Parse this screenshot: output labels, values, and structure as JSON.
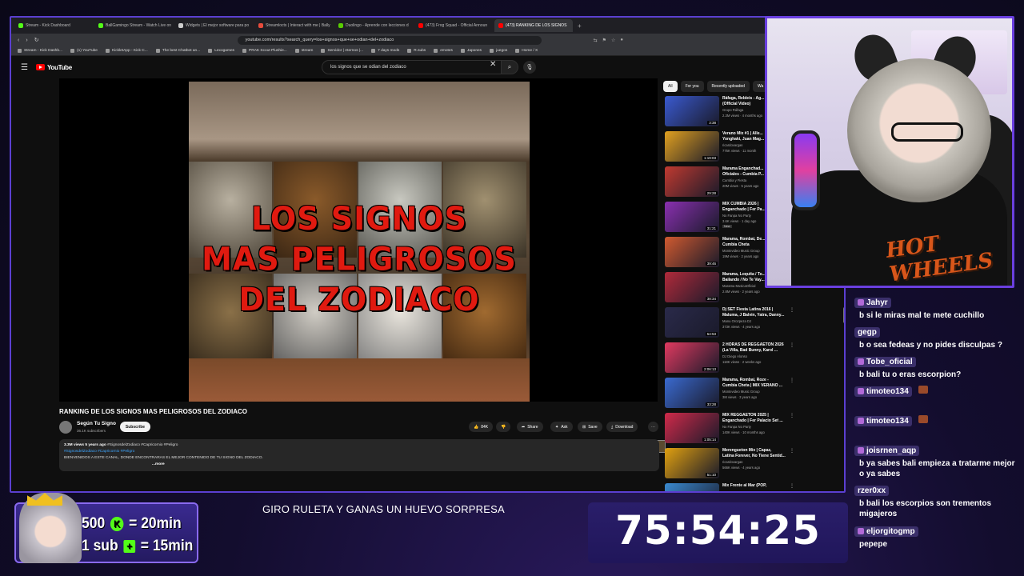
{
  "browser": {
    "tabs": [
      {
        "label": "Stream - Kick Dashboard",
        "color": "#53fc18"
      },
      {
        "label": "BallGamingo Stream - Watch Live on",
        "color": "#53fc18"
      },
      {
        "label": "Widgets | El mejor software para po",
        "color": "#cccccc"
      },
      {
        "label": "Streamlocts | Interact with me | Bally",
        "color": "#e74c3c"
      },
      {
        "label": "Duolingo - Aprende con lecciones d",
        "color": "#58cc02"
      },
      {
        "label": "(473) Frog Squad - Official Announ",
        "color": "#ff0000"
      },
      {
        "label": "(473) RANKING DE LOS SIGNOS",
        "color": "#ff0000"
      }
    ],
    "new_tab": "+",
    "url": "youtube.com/results?search_query=los+signos+que+se+odian+del+zodiaco",
    "bookmarks": [
      "Stream - Kick Dashb...",
      "(1) YouTube",
      "KickletApp - Kick C...",
      "The best Chatbot an...",
      "Lexogames",
      "PRAK Scout Plushie...",
      "stream",
      "Servidor | Aternos |...",
      "7 days mods",
      "R.subs",
      "emotes",
      "Japones",
      "juegos",
      "Home / X"
    ]
  },
  "youtube": {
    "logo": "YouTube",
    "search_value": "los signos que se odian del zodiaco",
    "thumbnail_text": "LOS SIGNOS\nMAS PELIGROSOS\nDEL ZODIACO",
    "video_title": "RANKING DE LOS SIGNOS MAS PELIGROSOS DEL ZODIACO",
    "channel_name": "Según Tu Signo",
    "channel_subs": "36.1K subscribers",
    "subscribe_label": "Subscribe",
    "like_count": "84K",
    "share_label": "Share",
    "ask_label": "Ask",
    "save_label": "Save",
    "download_label": "Download",
    "desc_meta": "3.3M views  5 years ago",
    "desc_meta_tags": "#SignosdelZodiaco #Capricornio #Peligro",
    "desc_tags": "#SignosdelZodiaco #Capricornio #Peligro",
    "desc_text": "BIENVENIDOS A ESTE CANAL, DONDE ENCONTRARAS EL MEJOR CONTENIDO  DE TU SIGNO DEL ZODIACO.",
    "desc_more": "...more",
    "chips": [
      "All",
      "For you",
      "Recently uploaded",
      "Wa"
    ],
    "recommendations": [
      {
        "title": "Ráfaga, Rebleis - Ag...",
        "title2": "(Official Video)",
        "channel": "Grupo Ráfaga",
        "meta": "2.3M views · 4 months ago",
        "duration": "3:38",
        "thumb": "#3a5ad0"
      },
      {
        "title": "Verano Mix #1 | Alle...",
        "title2": "Yonghaki, Juan Mag...",
        "channel": "ricardovargas",
        "meta": "775K views · 11 month",
        "duration": "1:19:03",
        "thumb": "#e0a020"
      },
      {
        "title": "Marama Enganchad...",
        "title2": "Oficiales - Cumbia P...",
        "channel": "Cumbia y Fiesta",
        "meta": "20M views · 5 years ago",
        "duration": "29:28",
        "thumb": "#c03a30"
      },
      {
        "title": "MIX CUMBIA 2026 |",
        "title2": "Enganchado | Fer Pa...",
        "channel": "No Fanpa No Party",
        "meta": "3.6K views · 1 day ago",
        "duration": "31:21",
        "thumb": "#8a30b0",
        "badge": "New"
      },
      {
        "title": "Marama, Rombai, De...",
        "title2": "Cumbia Cheta",
        "channel": "Montevideo Music Group",
        "meta": "19M views · 2 years ago",
        "duration": "39:46",
        "thumb": "#d05a30"
      },
      {
        "title": "Marama, Loquita / To...",
        "title2": "Bailando / No Te Vay...",
        "channel": "Marama MusicaOficial",
        "meta": "2.8M views · 2 years ago",
        "duration": "38:34",
        "thumb": "#b02a3a"
      },
      {
        "title": "Dj SET Fiesta Latina 2016 |",
        "title2": "Maluma, J Balvin, Yatra, Danny...",
        "channel": "Manu Orozpeza DJ",
        "meta": "373K views · 4 years ago",
        "duration": "54:53",
        "thumb": "#2a2a4a"
      },
      {
        "title": "2 HORAS DE REGGAETON 2026",
        "title2": "(La Villa, Bad Bunny, Karol ...",
        "channel": "DJ Diego Alonso",
        "meta": "118K views · 2 weeks ago",
        "duration": "2:06:13",
        "thumb": "#e03a60"
      },
      {
        "title": "Marama, Rombai, Roze -",
        "title2": "Cumbia Cheta | MIX VERANO ...",
        "channel": "Montevideo Music Group",
        "meta": "3M views · 3 years ago",
        "duration": "33:28",
        "thumb": "#3a6ad0"
      },
      {
        "title": "MIX REGGAETON 2025 |",
        "title2": "Enganchado | Fer Palacio Set ...",
        "channel": "No Fanpa No Party",
        "meta": "140K views · 10 months ago",
        "duration": "1:05:14",
        "thumb": "#d02a4a"
      },
      {
        "title": "Merengueton Mix | Capaz,",
        "title2": "Latina Forever, No Tiene Sentid...",
        "channel": "ricardovargas",
        "meta": "566K views · 4 years ago",
        "duration": "51:10",
        "thumb": "#e0a010"
      },
      {
        "title": "Mix Frente al Mar (POP,",
        "title2": "",
        "channel": "",
        "meta": "",
        "duration": "",
        "thumb": "#3a8ad0"
      }
    ]
  },
  "webcam": {
    "shirt_text": "HOT WHEELS"
  },
  "chat": [
    {
      "user": "Jahyr",
      "text": "b si le miras mal te mete cuchillo"
    },
    {
      "user": "gegp",
      "text": "b o sea fedeas y no pides disculpas ?"
    },
    {
      "user": "Tobe_oficial",
      "text": "b bali tu o eras escorpion?"
    },
    {
      "user": "timoteo134",
      "text": ""
    },
    {
      "user": "timoteo134",
      "text": ""
    },
    {
      "user": "joisrnen_aqp",
      "text": "b ya sabes bali empieza a tratarme mejor o ya sabes"
    },
    {
      "user": "rzer0xx",
      "text": "b bali los escorpios son trementos migajeros"
    },
    {
      "user": "eljorgitogmp",
      "text": "pepepe"
    }
  ],
  "overlay": {
    "promo_line1_a": "500",
    "promo_line1_b": "= 20min",
    "promo_line2_a": "1 sub",
    "promo_line2_b": "= 15min",
    "kick_glyph": "K",
    "ticker": "GIRO RULETA Y GANAS UN HUEVO SORPRESA",
    "timer": "75:54:25"
  }
}
